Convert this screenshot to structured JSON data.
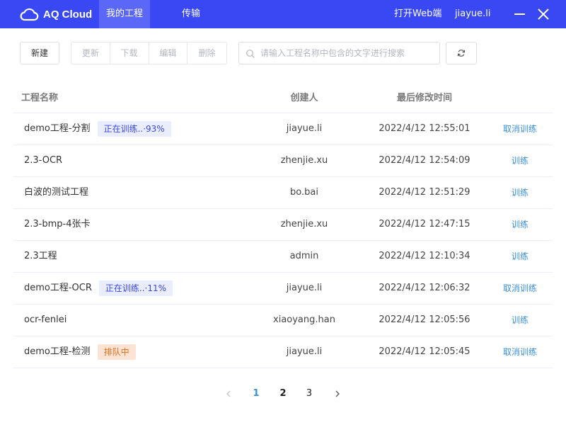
{
  "header": {
    "app_name": "AQ Cloud",
    "tabs": [
      {
        "label": "我的工程",
        "active": true
      },
      {
        "label": "传输",
        "active": false
      }
    ],
    "open_web": "打开Web端",
    "user": "jiayue.li",
    "bar_color": "#3a48f3"
  },
  "toolbar": {
    "new": "新建",
    "update": "更新",
    "download": "下载",
    "edit": "编辑",
    "delete": "删除",
    "search_placeholder": "请输入工程名称中包含的文字进行搜索"
  },
  "table": {
    "columns": [
      "工程名称",
      "创建人",
      "最后修改时间"
    ],
    "rows": [
      {
        "name": "demo工程-分割",
        "badge": "正在训练..·93%",
        "creator": "jiayue.li",
        "time": "2022/4/12 12:55:01",
        "action": "取消训练"
      },
      {
        "name": "2.3-OCR",
        "badge": "",
        "creator": "zhenjie.xu",
        "time": "2022/4/12 12:54:09",
        "action": "训练"
      },
      {
        "name": "白波的测试工程",
        "badge": "",
        "creator": "bo.bai",
        "time": "2022/4/12 12:51:29",
        "action": "训练"
      },
      {
        "name": "2.3-bmp-4张卡",
        "badge": "",
        "creator": "zhenjie.xu",
        "time": "2022/4/12 12:47:15",
        "action": "训练"
      },
      {
        "name": "2.3工程",
        "badge": "",
        "creator": "admin",
        "time": "2022/4/12 12:10:34",
        "action": "训练"
      },
      {
        "name": "demo工程-OCR",
        "badge": "正在训练..·11%",
        "creator": "jiayue.li",
        "time": "2022/4/12 12:06:32",
        "action": "取消训练"
      },
      {
        "name": "ocr-fenlei",
        "badge": "",
        "creator": "xiaoyang.han",
        "time": "2022/4/12 12:05:56",
        "action": "训练"
      },
      {
        "name": "demo工程-检测",
        "badge": "排队中",
        "creator": "jiayue.li",
        "time": "2022/4/12 12:05:45",
        "action": "取消训练"
      }
    ]
  },
  "pagination": {
    "pages": [
      "1",
      "2",
      "3"
    ],
    "current": "1"
  }
}
